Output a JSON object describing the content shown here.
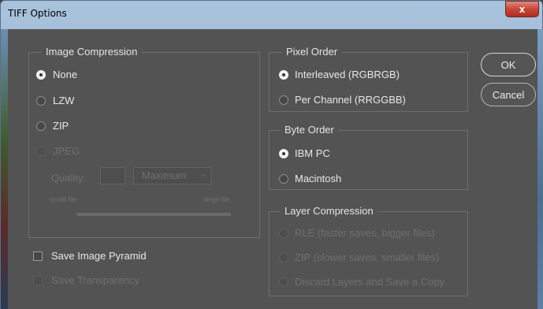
{
  "window": {
    "title": "TIFF Options",
    "close_glyph": "x"
  },
  "image_compression": {
    "legend": "Image Compression",
    "options": [
      {
        "label": "None",
        "checked": true,
        "enabled": true
      },
      {
        "label": "LZW",
        "checked": false,
        "enabled": true
      },
      {
        "label": "ZIP",
        "checked": false,
        "enabled": true
      },
      {
        "label": "JPEG",
        "checked": false,
        "enabled": false
      }
    ],
    "quality_label": "Quality:",
    "quality_value": "",
    "quality_select": "Maximum",
    "slider_min_label": "small file",
    "slider_max_label": "large file"
  },
  "pixel_order": {
    "legend": "Pixel Order",
    "options": [
      {
        "label": "Interleaved (RGBRGB)",
        "checked": true
      },
      {
        "label": "Per Channel (RRGGBB)",
        "checked": false
      }
    ]
  },
  "byte_order": {
    "legend": "Byte Order",
    "options": [
      {
        "label": "IBM PC",
        "checked": true
      },
      {
        "label": "Macintosh",
        "checked": false
      }
    ]
  },
  "layer_compression": {
    "legend": "Layer Compression",
    "options": [
      {
        "label": "RLE (faster saves, bigger files)",
        "enabled": false
      },
      {
        "label": "ZIP (slower saves, smaller files)",
        "enabled": false
      },
      {
        "label": "Discard Layers and Save a Copy",
        "enabled": false
      }
    ]
  },
  "checkboxes": {
    "save_pyramid": {
      "label": "Save Image Pyramid",
      "checked": false,
      "enabled": true
    },
    "save_transparency": {
      "label": "Save Transparency",
      "checked": false,
      "enabled": false
    }
  },
  "buttons": {
    "ok": "OK",
    "cancel": "Cancel"
  },
  "icons": {
    "close": "close-icon",
    "dropdown": "chevron-down-icon"
  }
}
